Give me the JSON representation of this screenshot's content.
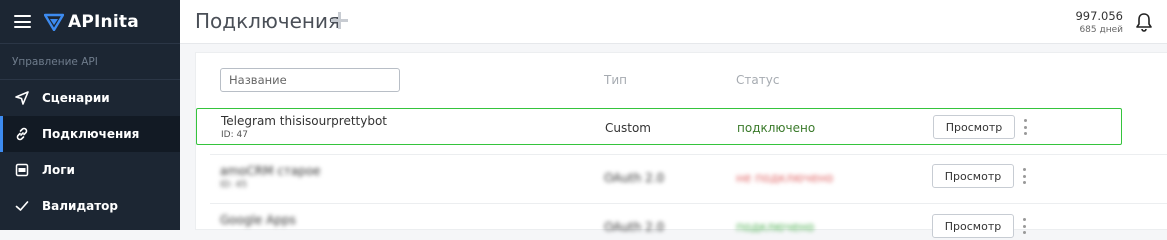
{
  "app": {
    "brand": "APInita"
  },
  "sidebar": {
    "section_label": "Управление API",
    "items": [
      {
        "label": "Сценарии",
        "icon": "send-icon",
        "active": false
      },
      {
        "label": "Подключения",
        "icon": "link-icon",
        "active": true
      },
      {
        "label": "Логи",
        "icon": "log-icon",
        "active": false
      },
      {
        "label": "Валидатор",
        "icon": "check-icon",
        "active": false
      }
    ]
  },
  "header": {
    "title": "Подключения",
    "balance": "997.056",
    "days_left": "685 дней"
  },
  "table": {
    "search_placeholder": "Название",
    "columns": {
      "type": "Тип",
      "status": "Статус"
    },
    "rows": [
      {
        "name": "Telegram thisisourprettybot",
        "id": "ID: 47",
        "type": "Custom",
        "status": "подключено",
        "action": "Просмотр"
      },
      {
        "name": "amoCRM старое",
        "id": "ID: 45",
        "type": "OAuth 2.0",
        "status": "не подключено",
        "action": "Просмотр"
      },
      {
        "name": "Google Apps",
        "id": "ID: 40",
        "type": "OAuth 2.0",
        "status": "подключено",
        "action": "Просмотр"
      }
    ]
  },
  "colors": {
    "sidebar_bg": "#1c2633",
    "accent": "#3d8bf0",
    "highlight_border": "#35c43d",
    "status_connected": "#3a7a2a"
  }
}
